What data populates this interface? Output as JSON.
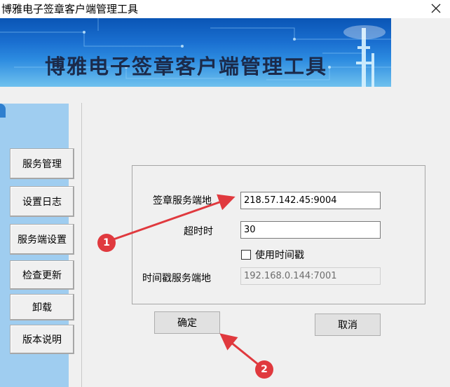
{
  "window": {
    "title": "博雅电子签章客户端管理工具"
  },
  "banner": {
    "title": "博雅电子签章客户端管理工具"
  },
  "sidebar": {
    "items": [
      {
        "label": "服务管理"
      },
      {
        "label": "设置日志"
      },
      {
        "label": "服务端设置"
      },
      {
        "label": "检查更新"
      },
      {
        "label": "卸载"
      },
      {
        "label": "版本说明"
      }
    ]
  },
  "form": {
    "server_label": "签章服务端地",
    "server_value": "218.57.142.45:9004",
    "timeout_label": "超时时",
    "timeout_value": "30",
    "timestamp_checkbox_label": "使用时间戳",
    "timestamp_checked": false,
    "timestamp_server_label": "时间戳服务端地",
    "timestamp_server_value": "192.168.0.144:7001"
  },
  "buttons": {
    "confirm": "确定",
    "cancel": "取消"
  },
  "annotations": {
    "marker1": "1",
    "marker2": "2",
    "color": "#e0393e"
  },
  "icons": {
    "close": "close-icon"
  }
}
